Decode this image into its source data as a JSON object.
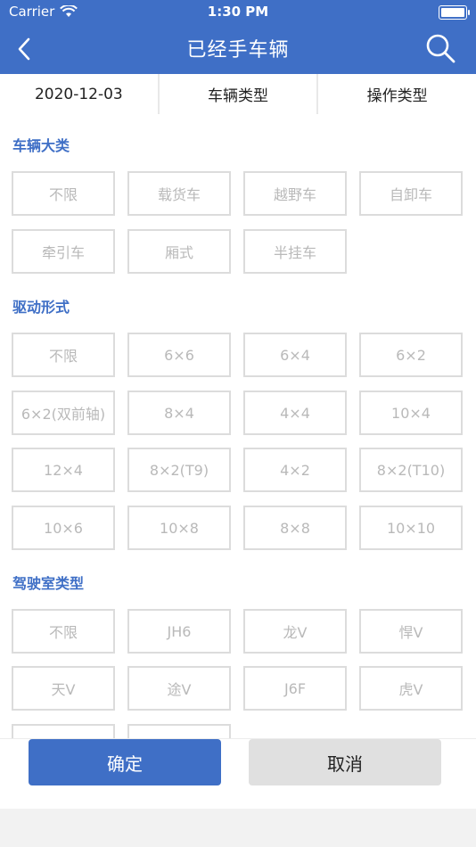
{
  "status": {
    "carrier": "Carrier",
    "time": "1:30 PM"
  },
  "nav": {
    "title": "已经手车辆"
  },
  "filters": [
    "2020-12-03",
    "车辆类型",
    "操作类型"
  ],
  "sections": [
    {
      "title": "车辆大类",
      "options": [
        "不限",
        "载货车",
        "越野车",
        "自卸车",
        "牵引车",
        "厢式",
        "半挂车"
      ]
    },
    {
      "title": "驱动形式",
      "options": [
        "不限",
        "6×6",
        "6×4",
        "6×2",
        "6×2(双前轴)",
        "8×4",
        "4×4",
        "10×4",
        "12×4",
        "8×2(T9)",
        "4×2",
        "8×2(T10)",
        "10×6",
        "10×8",
        "8×8",
        "10×10"
      ]
    },
    {
      "title": "驾驶室类型",
      "options": [
        "不限",
        "JH6",
        "龙V",
        "悍V",
        "天V",
        "途V",
        "J6F",
        "虎V"
      ]
    }
  ],
  "buttons": {
    "confirm": "确定",
    "cancel": "取消"
  },
  "colors": {
    "accent": "#3f6fc6",
    "option_text": "#b9b9b9",
    "option_border": "#dcdcdc"
  }
}
